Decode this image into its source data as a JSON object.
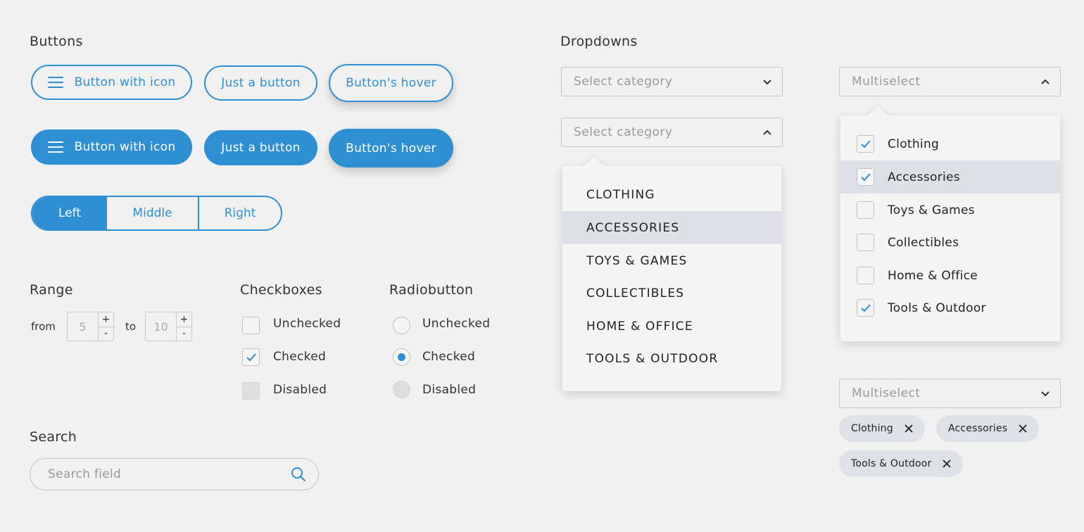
{
  "colors": {
    "accent": "#2f8fd3",
    "background": "#f1f1f1",
    "highlight": "#dde1e6"
  },
  "sections": {
    "buttons": "Buttons",
    "dropdowns": "Dropdowns",
    "range": "Range",
    "checkboxes": "Checkboxes",
    "radiobutton": "Radiobutton",
    "search": "Search"
  },
  "buttons": {
    "outline": {
      "with_icon": "Button with icon",
      "plain": "Just a button",
      "hover": "Button's hover"
    },
    "filled": {
      "with_icon": "Button with icon",
      "plain": "Just a button",
      "hover": "Button's hover"
    },
    "icon": "hamburger-menu-icon",
    "segmented": [
      "Left",
      "Middle",
      "Right"
    ],
    "segmented_selected": "Left"
  },
  "range": {
    "from_label": "from",
    "to_label": "to",
    "from_value": "5",
    "to_value": "10",
    "plus": "+",
    "minus": "-"
  },
  "checkboxes": [
    {
      "label": "Unchecked",
      "state": "unchecked"
    },
    {
      "label": "Checked",
      "state": "checked"
    },
    {
      "label": "Disabled",
      "state": "disabled"
    }
  ],
  "radios": [
    {
      "label": "Unchecked",
      "state": "unchecked"
    },
    {
      "label": "Checked",
      "state": "checked"
    },
    {
      "label": "Disabled",
      "state": "disabled"
    }
  ],
  "search": {
    "placeholder": "Search field",
    "icon": "search-icon"
  },
  "dropdown_single": {
    "placeholder": "Select category",
    "items": [
      "CLOTHING",
      "ACCESSORIES",
      "TOYS & GAMES",
      "COLLECTIBLES",
      "HOME & OFFICE",
      "TOOLS & OUTDOOR"
    ],
    "highlighted": "ACCESSORIES"
  },
  "multiselect": {
    "placeholder": "Multiselect",
    "items": [
      {
        "label": "Clothing",
        "checked": true
      },
      {
        "label": "Accessories",
        "checked": true
      },
      {
        "label": "Toys & Games",
        "checked": false
      },
      {
        "label": "Collectibles",
        "checked": false
      },
      {
        "label": "Home & Office",
        "checked": false
      },
      {
        "label": "Tools & Outdoor",
        "checked": true
      }
    ],
    "highlighted": "Accessories",
    "tags": [
      "Clothing",
      "Accessories",
      "Tools & Outdoor"
    ]
  }
}
